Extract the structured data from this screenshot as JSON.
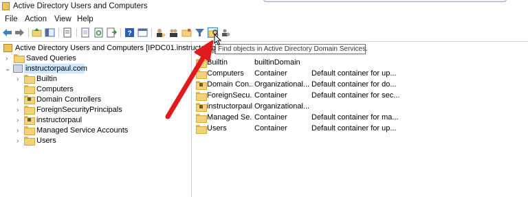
{
  "window": {
    "title": "Active Directory Users and Computers"
  },
  "menu": {
    "items": [
      "File",
      "Action",
      "View",
      "Help"
    ]
  },
  "toolbar": {
    "buttons": [
      "back-icon",
      "forward-icon",
      "up-folder-icon",
      "console-tree-icon",
      "properties-icon",
      "export-list-icon",
      "refresh-icon",
      "export-icon",
      "help-icon",
      "show-hide-icon",
      "new-user-icon",
      "new-group-icon",
      "new-ou-icon",
      "filter-icon",
      "find-icon",
      "add-to-group-icon"
    ],
    "tooltip": "Find objects in Active Directory Domain Services."
  },
  "tree": {
    "root": "Active Directory Users and Computers [IPDC01.instructorpa",
    "saved_queries": "Saved Queries",
    "domain": "instructorpaul.com",
    "children": [
      "Builtin",
      "Computers",
      "Domain Controllers",
      "ForeignSecurityPrincipals",
      "instructorpaul",
      "Managed Service Accounts",
      "Users"
    ]
  },
  "list": {
    "header_name_fragment": "me",
    "rows": [
      {
        "name": "Builtin",
        "type": "builtinDomain",
        "description": ""
      },
      {
        "name": "Computers",
        "type": "Container",
        "description": "Default container for up..."
      },
      {
        "name": "Domain Con...",
        "type": "Organizational...",
        "description": "Default container for do..."
      },
      {
        "name": "ForeignSecu...",
        "type": "Container",
        "description": "Default container for sec..."
      },
      {
        "name": "instructorpaul",
        "type": "Organizational...",
        "description": ""
      },
      {
        "name": "Managed Se...",
        "type": "Container",
        "description": "Default container for ma..."
      },
      {
        "name": "Users",
        "type": "Container",
        "description": "Default container for up..."
      }
    ]
  },
  "colors": {
    "selection": "#cce8ff",
    "annotation_arrow": "#e11b1b",
    "folder": "#f3d37a"
  }
}
